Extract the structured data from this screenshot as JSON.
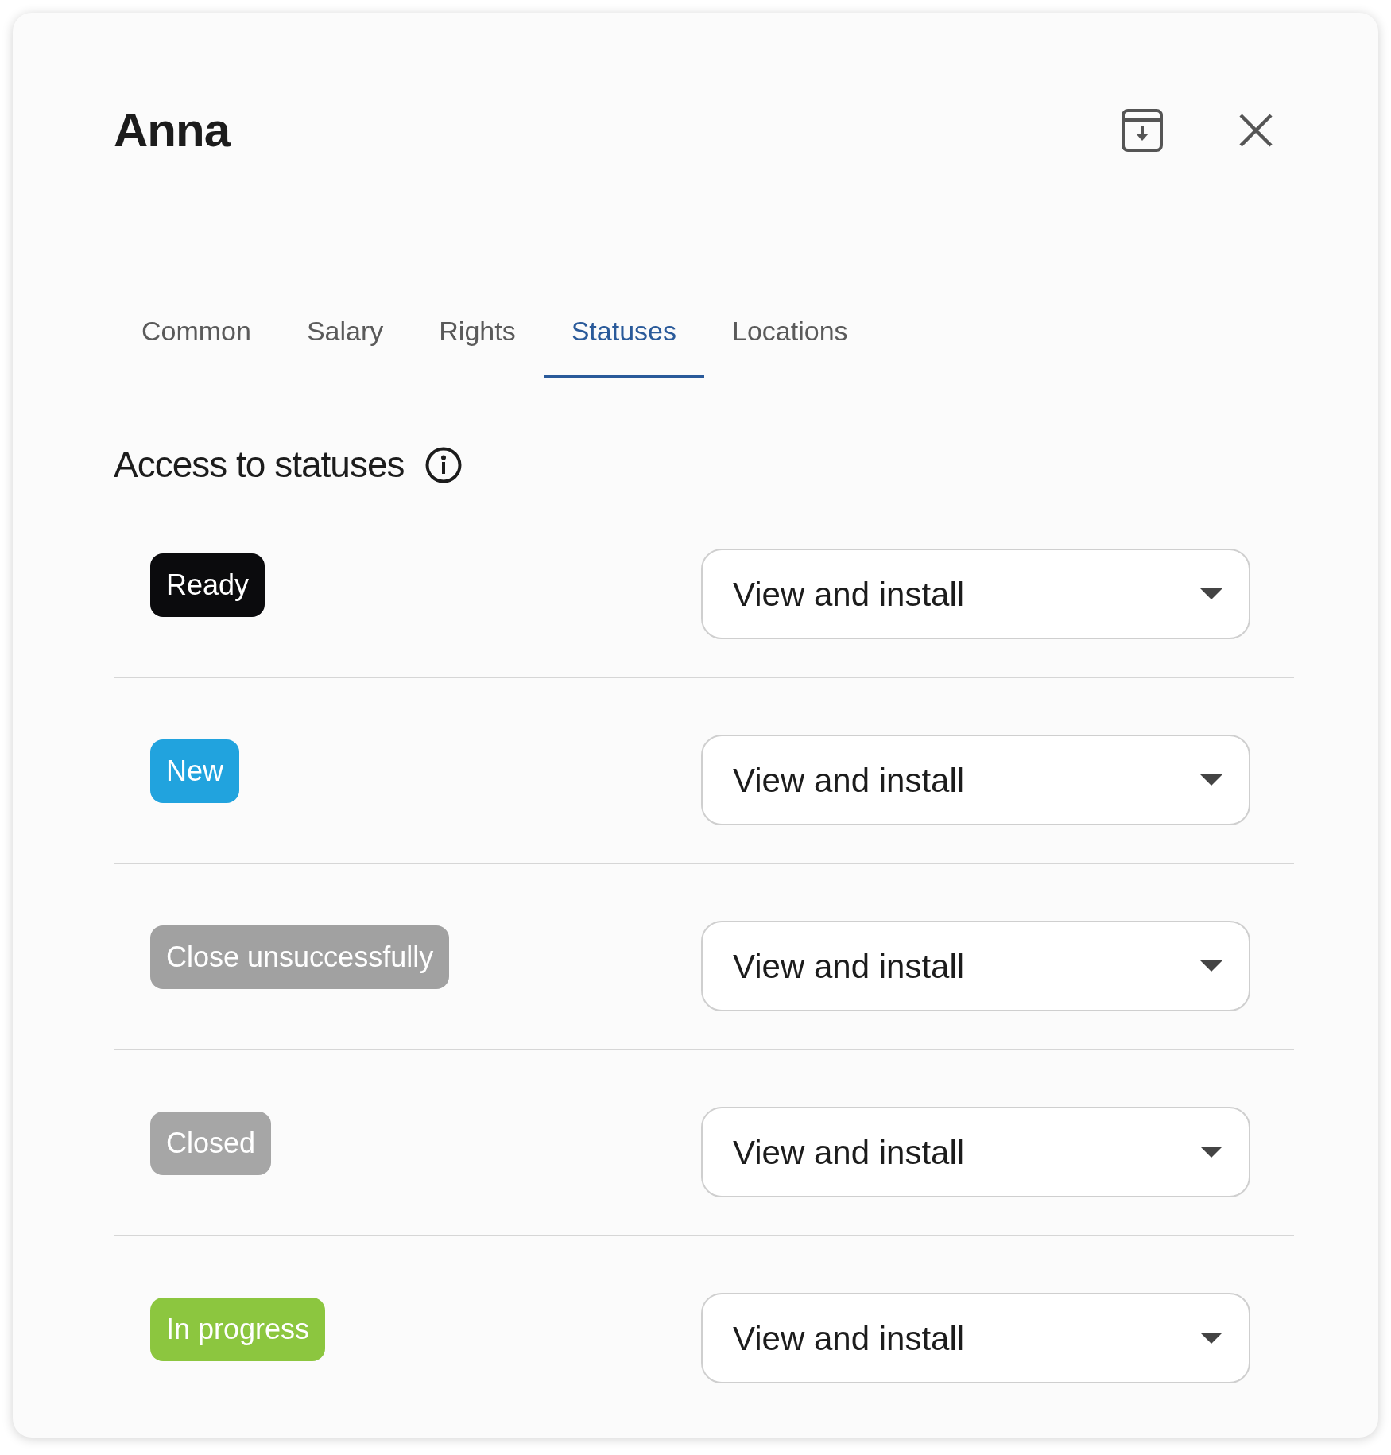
{
  "title": "Anna",
  "tabs": [
    {
      "label": "Common",
      "selected": false
    },
    {
      "label": "Salary",
      "selected": false
    },
    {
      "label": "Rights",
      "selected": false
    },
    {
      "label": "Statuses",
      "selected": true
    },
    {
      "label": "Locations",
      "selected": false
    }
  ],
  "section": {
    "heading": "Access to statuses"
  },
  "statuses": [
    {
      "label": "Ready",
      "color": "#0b0b0d",
      "access": "View and install"
    },
    {
      "label": "New",
      "color": "#21a3de",
      "access": "View and install"
    },
    {
      "label": "Close unsuccessfully",
      "color": "#a1a1a1",
      "access": "View and install"
    },
    {
      "label": "Closed",
      "color": "#a6a6a6",
      "access": "View and install"
    },
    {
      "label": "In progress",
      "color": "#8cc63f",
      "access": "View and install"
    }
  ]
}
